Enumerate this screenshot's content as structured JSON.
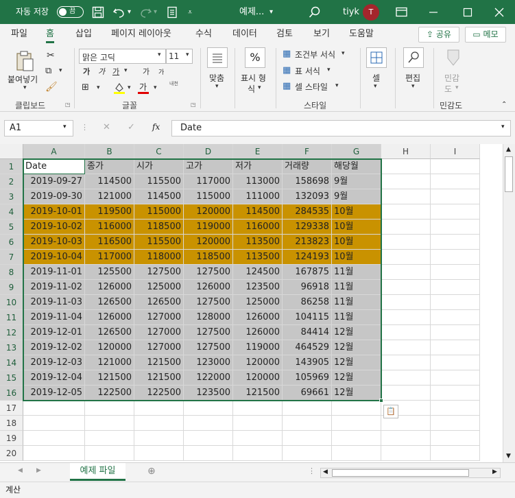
{
  "titlebar": {
    "autosave_label": "자동 저장",
    "toggle_state": "끔",
    "filename": "예제...",
    "user_name": "tiyk",
    "avatar_initial": "T"
  },
  "ribbon_tabs": [
    "파일",
    "홈",
    "삽입",
    "페이지 레이아웃",
    "수식",
    "데이터",
    "검토",
    "보기",
    "도움말"
  ],
  "share_label": "공유",
  "memo_label": "메모",
  "ribbon": {
    "paste_label": "붙여넣기",
    "font_name": "맑은 고딕",
    "font_size": "11",
    "bold": "가",
    "italic": "가",
    "underline": "가",
    "grow_font": "가",
    "shrink_font": "가",
    "phonetic": "내천",
    "align_label": "맞춤",
    "number_format_label1": "표시 형",
    "number_format_label2": "식",
    "percent_symbol": "%",
    "conditional_format": "조건부 서식",
    "table_format": "표 서식",
    "cell_style": "셀 스타일",
    "cells_label": "셀",
    "edit_label": "편집",
    "sensitivity_label1": "민감",
    "sensitivity_label2": "도",
    "groups": {
      "clipboard": "클립보드",
      "font": "글꼴",
      "style": "스타일",
      "sensitivity": "민감도"
    }
  },
  "formula_bar": {
    "name_box": "A1",
    "fx": "fx",
    "content": "Date"
  },
  "grid": {
    "columns": [
      "A",
      "B",
      "C",
      "D",
      "E",
      "F",
      "G",
      "H",
      "I"
    ],
    "row_numbers": [
      "1",
      "2",
      "3",
      "4",
      "5",
      "6",
      "7",
      "8",
      "9",
      "10",
      "11",
      "12",
      "13",
      "14",
      "15",
      "16",
      "17",
      "18",
      "19",
      "20"
    ],
    "header_row": [
      "Date",
      "종가",
      "시가",
      "고가",
      "저가",
      "거래량",
      "해당월"
    ],
    "rows": [
      [
        "2019-09-27",
        "114500",
        "115500",
        "117000",
        "113000",
        "158698",
        "9월"
      ],
      [
        "2019-09-30",
        "121000",
        "114500",
        "115000",
        "111000",
        "132093",
        "9월"
      ],
      [
        "2019-10-01",
        "119500",
        "115000",
        "120000",
        "114500",
        "284535",
        "10월"
      ],
      [
        "2019-10-02",
        "116000",
        "118500",
        "119000",
        "116000",
        "129338",
        "10월"
      ],
      [
        "2019-10-03",
        "116500",
        "115500",
        "120000",
        "113500",
        "213823",
        "10월"
      ],
      [
        "2019-10-04",
        "117000",
        "118000",
        "118500",
        "113500",
        "124193",
        "10월"
      ],
      [
        "2019-11-01",
        "125500",
        "127500",
        "127500",
        "124500",
        "167875",
        "11월"
      ],
      [
        "2019-11-02",
        "126000",
        "125000",
        "126000",
        "123500",
        "96918",
        "11월"
      ],
      [
        "2019-11-03",
        "126500",
        "126500",
        "127500",
        "125000",
        "86258",
        "11월"
      ],
      [
        "2019-11-04",
        "126000",
        "127000",
        "128000",
        "126000",
        "104115",
        "11월"
      ],
      [
        "2019-12-01",
        "126500",
        "127000",
        "127500",
        "126000",
        "84414",
        "12월"
      ],
      [
        "2019-12-02",
        "120000",
        "127000",
        "127500",
        "119000",
        "464529",
        "12월"
      ],
      [
        "2019-12-03",
        "121000",
        "121500",
        "123000",
        "120000",
        "143905",
        "12월"
      ],
      [
        "2019-12-04",
        "121500",
        "121500",
        "122000",
        "120000",
        "105969",
        "12월"
      ],
      [
        "2019-12-05",
        "122500",
        "122500",
        "123500",
        "121500",
        "69661",
        "12월"
      ]
    ],
    "highlighted_rows": [
      3,
      4,
      5,
      6
    ],
    "highlight_color": "#c99200",
    "selection_fill": "#c6c6c6"
  },
  "sheet_tab": "예제 파일",
  "status": "계산",
  "colors": {
    "brand": "#217346"
  }
}
